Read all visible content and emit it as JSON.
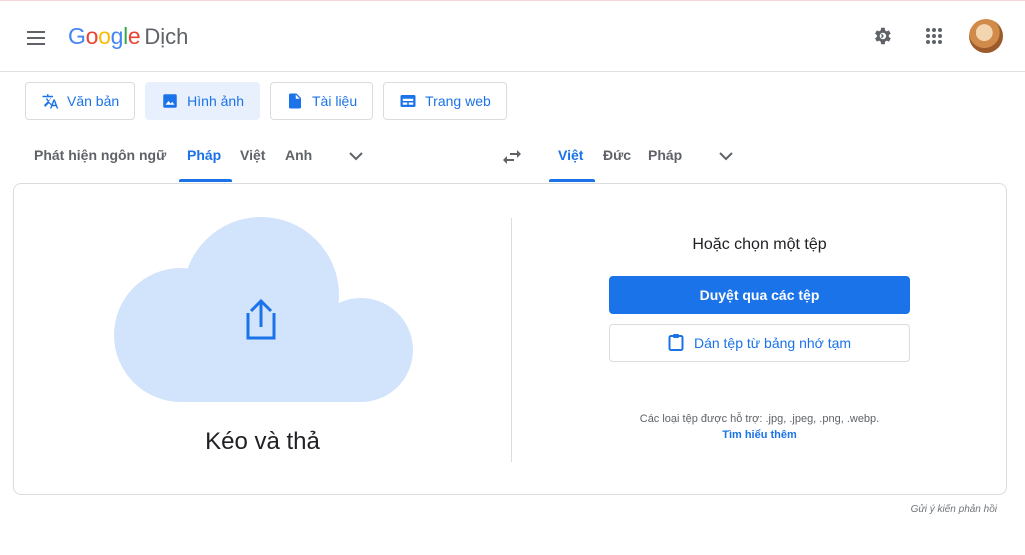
{
  "header": {
    "logo_letters": [
      {
        "ch": "G",
        "color": "#4285f4"
      },
      {
        "ch": "o",
        "color": "#ea4335"
      },
      {
        "ch": "o",
        "color": "#fbbc05"
      },
      {
        "ch": "g",
        "color": "#4285f4"
      },
      {
        "ch": "l",
        "color": "#34a853"
      },
      {
        "ch": "e",
        "color": "#ea4335"
      }
    ],
    "product_name": "Dịch",
    "icons": [
      "menu-icon",
      "settings-icon",
      "apps-icon",
      "account-avatar"
    ]
  },
  "modes": [
    {
      "label": "Văn bản",
      "icon": "translate-icon",
      "active": false
    },
    {
      "label": "Hình ảnh",
      "icon": "image-icon",
      "active": true
    },
    {
      "label": "Tài liệu",
      "icon": "document-icon",
      "active": false
    },
    {
      "label": "Trang web",
      "icon": "website-icon",
      "active": false
    }
  ],
  "source_langs": {
    "detect": "Phát hiện ngôn ngữ",
    "items": [
      "Pháp",
      "Việt",
      "Anh"
    ],
    "active": "Pháp"
  },
  "target_langs": {
    "items": [
      "Việt",
      "Đức",
      "Pháp"
    ],
    "active": "Việt"
  },
  "upload": {
    "drop_label": "Kéo và thả",
    "or_choose": "Hoặc chọn một tệp",
    "browse_button": "Duyệt qua các tệp",
    "paste_button": "Dán tệp từ bảng nhớ tạm",
    "supported_types": "Các loại tệp được hỗ trợ: .jpg, .jpeg, .png, .webp.",
    "learn_more": "Tìm hiểu thêm"
  },
  "feedback": "Gửi ý kiến phản hồi",
  "colors": {
    "accent": "#1a73e8",
    "accent_light": "#e8f0fe",
    "cloud": "#d2e3fc"
  }
}
